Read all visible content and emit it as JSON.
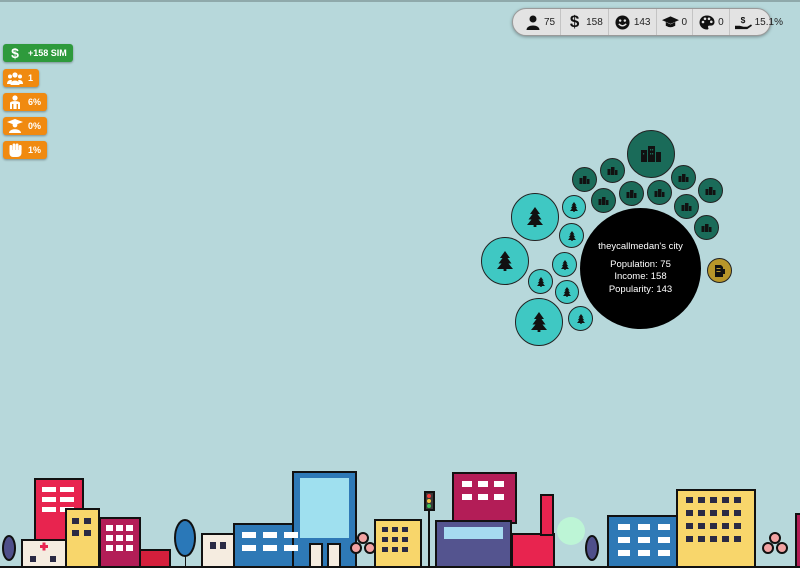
{
  "stats": [
    {
      "icon": "person-icon",
      "value": "75"
    },
    {
      "icon": "dollar-icon",
      "value": "158"
    },
    {
      "icon": "smiley-icon",
      "value": "143"
    },
    {
      "icon": "graduation-cap-icon",
      "value": "0"
    },
    {
      "icon": "palette-icon",
      "value": "0"
    },
    {
      "icon": "hand-coin-icon",
      "value": "15.1%"
    }
  ],
  "left_buttons": [
    {
      "icon": "dollar-icon",
      "label": "+158 SIM",
      "color": "#2e9a3c"
    },
    {
      "icon": "users-icon",
      "label": "1",
      "color": "#f08a10"
    },
    {
      "icon": "elder-icon",
      "label": "6%",
      "color": "#f08a10"
    },
    {
      "icon": "student-icon",
      "label": "0%",
      "color": "#f08a10"
    },
    {
      "icon": "fist-icon",
      "label": "1%",
      "color": "#f08a10"
    }
  ],
  "city": {
    "name": "theycallmedan's city",
    "population": "Population: 75",
    "income": "Income: 158",
    "popularity": "Popularity: 143"
  },
  "colors": {
    "background": "#b7d8db",
    "tree_bubble": "#3fc8c3",
    "building_bubble": "#1a6b59",
    "city_core": "#000000"
  }
}
